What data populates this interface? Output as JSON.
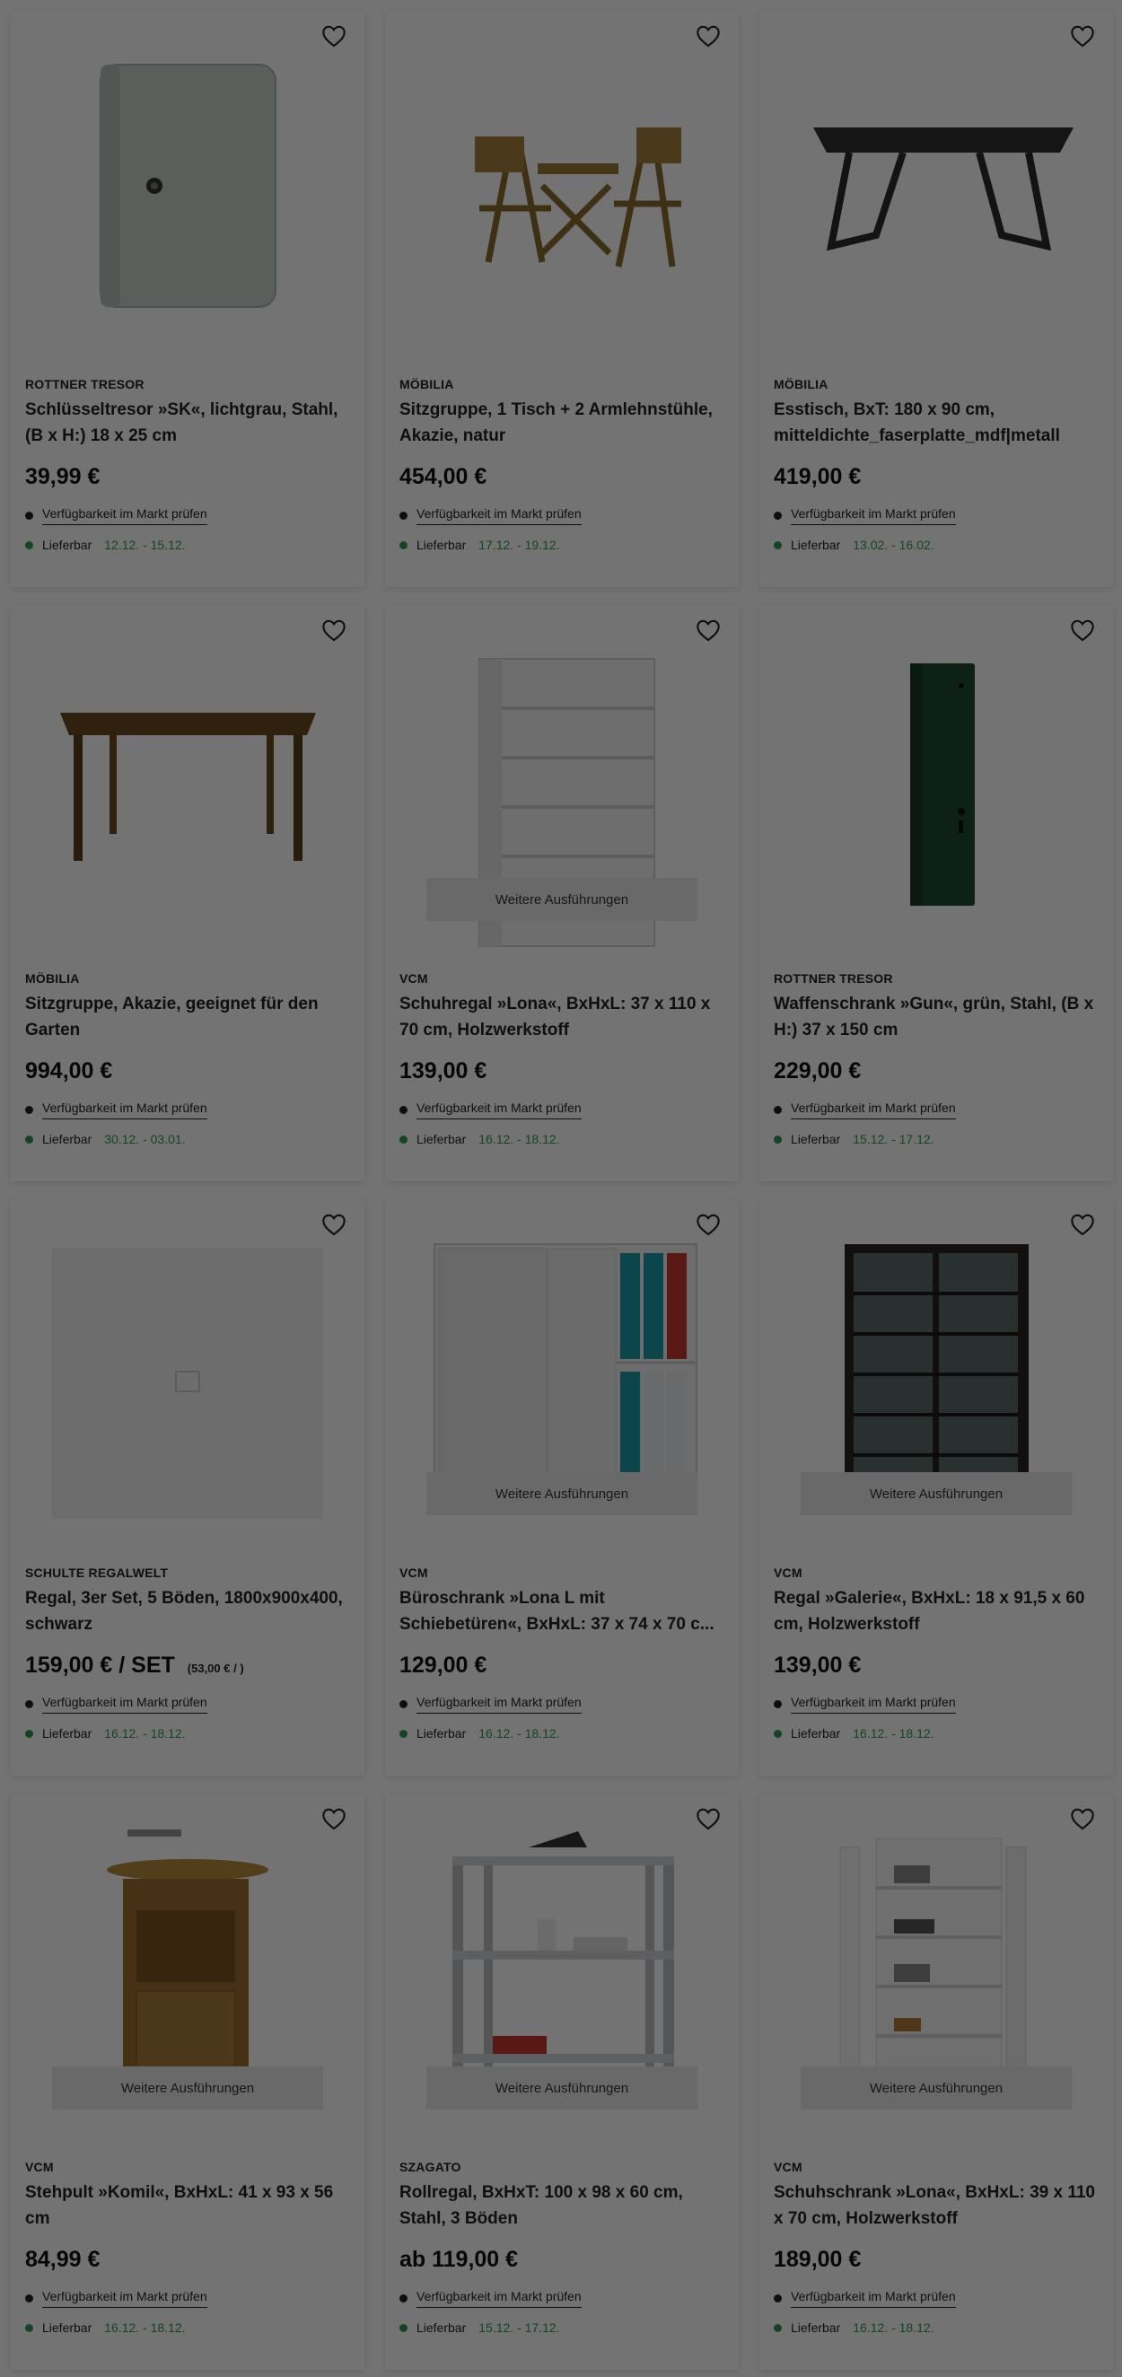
{
  "product_list": {
    "variants_label": "Weitere Ausführungen",
    "availability_label": "Verfügbarkeit im Markt prüfen",
    "delivery_label": "Lieferbar",
    "favorite_icon": "heart-outline-icon",
    "colors": {
      "delivery_dates": "#2e9a4e",
      "availability_dot": "#222222",
      "delivery_dot": "#2e9a4e"
    },
    "products": [
      {
        "brand": "ROTTNER TRESOR",
        "title": "Schlüsseltresor »SK«, lichtgrau, Stahl, (B x H:) 18 x 25 cm",
        "price": "39,99 €",
        "unit_price": "",
        "delivery": "12.12. - 15.12.",
        "has_variants": false,
        "image": "key-safe"
      },
      {
        "brand": "MÖBILIA",
        "title": "Sitzgruppe, 1 Tisch + 2 Armlehnstühle, Akazie, natur",
        "price": "454,00 €",
        "unit_price": "",
        "delivery": "17.12. - 19.12.",
        "has_variants": false,
        "image": "bistro-set"
      },
      {
        "brand": "MÖBILIA",
        "title": "Esstisch, BxT: 180 x 90 cm, mitteldichte_faserplatte_mdf|metall",
        "price": "419,00 €",
        "unit_price": "",
        "delivery": "13.02. - 16.02.",
        "has_variants": false,
        "image": "dining-table"
      },
      {
        "brand": "MÖBILIA",
        "title": "Sitzgruppe, Akazie, geeignet für den Garten",
        "price": "994,00 €",
        "unit_price": "",
        "delivery": "30.12. - 03.01.",
        "has_variants": false,
        "image": "garden-table"
      },
      {
        "brand": "VCM",
        "title": "Schuhregal »Lona«, BxHxL: 37 x 110 x 70 cm, Holzwerkstoff",
        "price": "139,00 €",
        "unit_price": "",
        "delivery": "16.12. - 18.12.",
        "has_variants": true,
        "image": "white-shelf"
      },
      {
        "brand": "ROTTNER TRESOR",
        "title": "Waffenschrank »Gun«, grün, Stahl, (B x H:) 37 x 150 cm",
        "price": "229,00 €",
        "unit_price": "",
        "delivery": "15.12. - 17.12.",
        "has_variants": false,
        "image": "gun-cabinet"
      },
      {
        "brand": "SCHULTE REGALWELT",
        "title": "Regal, 3er Set, 5 Böden, 1800x900x400, schwarz",
        "price": "159,00 € / SET",
        "unit_price": "(53,00 € / )",
        "delivery": "16.12. - 18.12.",
        "has_variants": false,
        "image": "placeholder"
      },
      {
        "brand": "VCM",
        "title": "Büroschrank »Lona L mit Schiebetüren«, BxHxL: 37 x 74 x 70 c...",
        "price": "129,00 €",
        "unit_price": "",
        "delivery": "16.12. - 18.12.",
        "has_variants": true,
        "image": "office-cabinet"
      },
      {
        "brand": "VCM",
        "title": "Regal »Galerie«, BxHxL: 18 x 91,5 x 60 cm, Holzwerkstoff",
        "price": "139,00 €",
        "unit_price": "",
        "delivery": "16.12. - 18.12.",
        "has_variants": true,
        "image": "media-shelf"
      },
      {
        "brand": "VCM",
        "title": "Stehpult »Komil«, BxHxL: 41 x 93 x 56 cm",
        "price": "84,99 €",
        "unit_price": "",
        "delivery": "16.12. - 18.12.",
        "has_variants": true,
        "image": "standing-desk"
      },
      {
        "brand": "SZAGATO",
        "title": "Rollregal, BxHxT: 100 x 98 x 60 cm, Stahl, 3 Böden",
        "price": "ab 119,00 €",
        "unit_price": "",
        "delivery": "15.12. - 17.12.",
        "has_variants": true,
        "image": "rolling-shelf"
      },
      {
        "brand": "VCM",
        "title": "Schuhschrank »Lona«, BxHxL: 39 x 110 x 70 cm, Holzwerkstoff",
        "price": "189,00 €",
        "unit_price": "",
        "delivery": "16.12. - 18.12.",
        "has_variants": true,
        "image": "shoe-cabinet"
      }
    ]
  }
}
